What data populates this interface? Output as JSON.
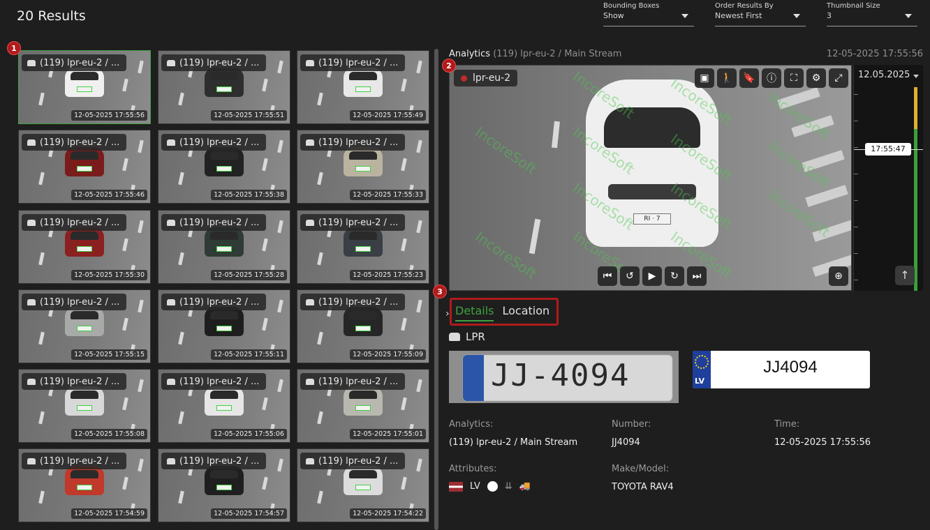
{
  "header": {
    "results_title": "20 Results",
    "filters": [
      {
        "label": "Bounding Boxes",
        "value": "Show"
      },
      {
        "label": "Order Results By",
        "value": "Newest First"
      },
      {
        "label": "Thumbnail Size",
        "value": "3"
      }
    ]
  },
  "badges": {
    "one": "1",
    "two": "2",
    "three": "3"
  },
  "thumbnails": [
    {
      "label": "(119) lpr-eu-2 / ...",
      "timestamp": "12-05-2025 17:55:56",
      "car_color": "#f0f0f0"
    },
    {
      "label": "(119) lpr-eu-2 / ...",
      "timestamp": "12-05-2025 17:55:51",
      "car_color": "#2e2e2e"
    },
    {
      "label": "(119) lpr-eu-2 / ...",
      "timestamp": "12-05-2025 17:55:49",
      "car_color": "#e8e8e8"
    },
    {
      "label": "(119) lpr-eu-2 / ...",
      "timestamp": "12-05-2025 17:55:46",
      "car_color": "#7a1c1c"
    },
    {
      "label": "(119) lpr-eu-2 / ...",
      "timestamp": "12-05-2025 17:55:38",
      "car_color": "#222"
    },
    {
      "label": "(119) lpr-eu-2 / ...",
      "timestamp": "12-05-2025 17:55:33",
      "car_color": "#b9b3a0"
    },
    {
      "label": "(119) lpr-eu-2 / ...",
      "timestamp": "12-05-2025 17:55:30",
      "car_color": "#8b2020"
    },
    {
      "label": "(119) lpr-eu-2 / ...",
      "timestamp": "12-05-2025 17:55:28",
      "car_color": "#2f3b35"
    },
    {
      "label": "(119) lpr-eu-2 / ...",
      "timestamp": "12-05-2025 17:55:23",
      "car_color": "#3a3f45"
    },
    {
      "label": "(119) lpr-eu-2 / ...",
      "timestamp": "12-05-2025 17:55:15",
      "car_color": "#a8aaa8"
    },
    {
      "label": "(119) lpr-eu-2 / ...",
      "timestamp": "12-05-2025 17:55:11",
      "car_color": "#1e1e1e"
    },
    {
      "label": "(119) lpr-eu-2 / ...",
      "timestamp": "12-05-2025 17:55:09",
      "car_color": "#262626"
    },
    {
      "label": "(119) lpr-eu-2 / ...",
      "timestamp": "12-05-2025 17:55:08",
      "car_color": "#d8d8d8"
    },
    {
      "label": "(119) lpr-eu-2 / ...",
      "timestamp": "12-05-2025 17:55:06",
      "car_color": "#e6e6e6"
    },
    {
      "label": "(119) lpr-eu-2 / ...",
      "timestamp": "12-05-2025 17:55:01",
      "car_color": "#b8b8b0"
    },
    {
      "label": "(119) lpr-eu-2 / ...",
      "timestamp": "12-05-2025 17:54:59",
      "car_color": "#c0392b"
    },
    {
      "label": "(119) lpr-eu-2 / ...",
      "timestamp": "12-05-2025 17:54:57",
      "car_color": "#1f1f1f"
    },
    {
      "label": "(119) lpr-eu-2 / ...",
      "timestamp": "12-05-2025 17:54:22",
      "car_color": "#dcdcdc"
    }
  ],
  "analytics": {
    "prefix": "Analytics",
    "stream": "(119) lpr-eu-2 / Main Stream",
    "time": "12-05-2025 17:55:56"
  },
  "video": {
    "camera_name": "lpr-eu-2",
    "watermark": "IncoreSoft",
    "plate_text": "RI · 7",
    "toolbar_icons": [
      "person-card-icon",
      "walking-person-icon",
      "bookmark-icon",
      "info-icon",
      "fit-screen-icon",
      "settings-icon",
      "fullscreen-icon"
    ],
    "toolbar_glyphs": [
      "▣",
      "🚶",
      "🔖",
      "ⓘ",
      "⛶",
      "⚙",
      "⤢"
    ],
    "playback": [
      {
        "name": "skip-start-icon",
        "glyph": "⏮"
      },
      {
        "name": "rewind-10-icon",
        "glyph": "↺"
      },
      {
        "name": "play-icon",
        "glyph": "▶"
      },
      {
        "name": "forward-10-icon",
        "glyph": "↻"
      },
      {
        "name": "skip-end-icon",
        "glyph": "⏭"
      }
    ],
    "zoom_glyph": "⊕"
  },
  "timeline": {
    "date": "12.05.2025",
    "now": "17:55:47",
    "up_glyph": "↑"
  },
  "tabs": {
    "chevron": "›",
    "details": "Details",
    "location": "Location"
  },
  "lpr": {
    "section": "LPR",
    "crop_text": "JJ-4094",
    "plate_country": "LV",
    "plate_number": "JJ4094"
  },
  "details": {
    "analytics_label": "Analytics:",
    "analytics_value": "(119) lpr-eu-2 / Main Stream",
    "number_label": "Number:",
    "number_value": "JJ4094",
    "time_label": "Time:",
    "time_value": "12-05-2025 17:55:56",
    "attributes_label": "Attributes:",
    "country": "LV",
    "make_label": "Make/Model:",
    "make_value": "TOYOTA RAV4",
    "attr_icons": [
      "flag-lv-icon",
      "white-color-dot-icon",
      "direction-down-icon",
      "truck-icon"
    ],
    "direction_glyph": "⇊",
    "truck_glyph": "🚚"
  }
}
